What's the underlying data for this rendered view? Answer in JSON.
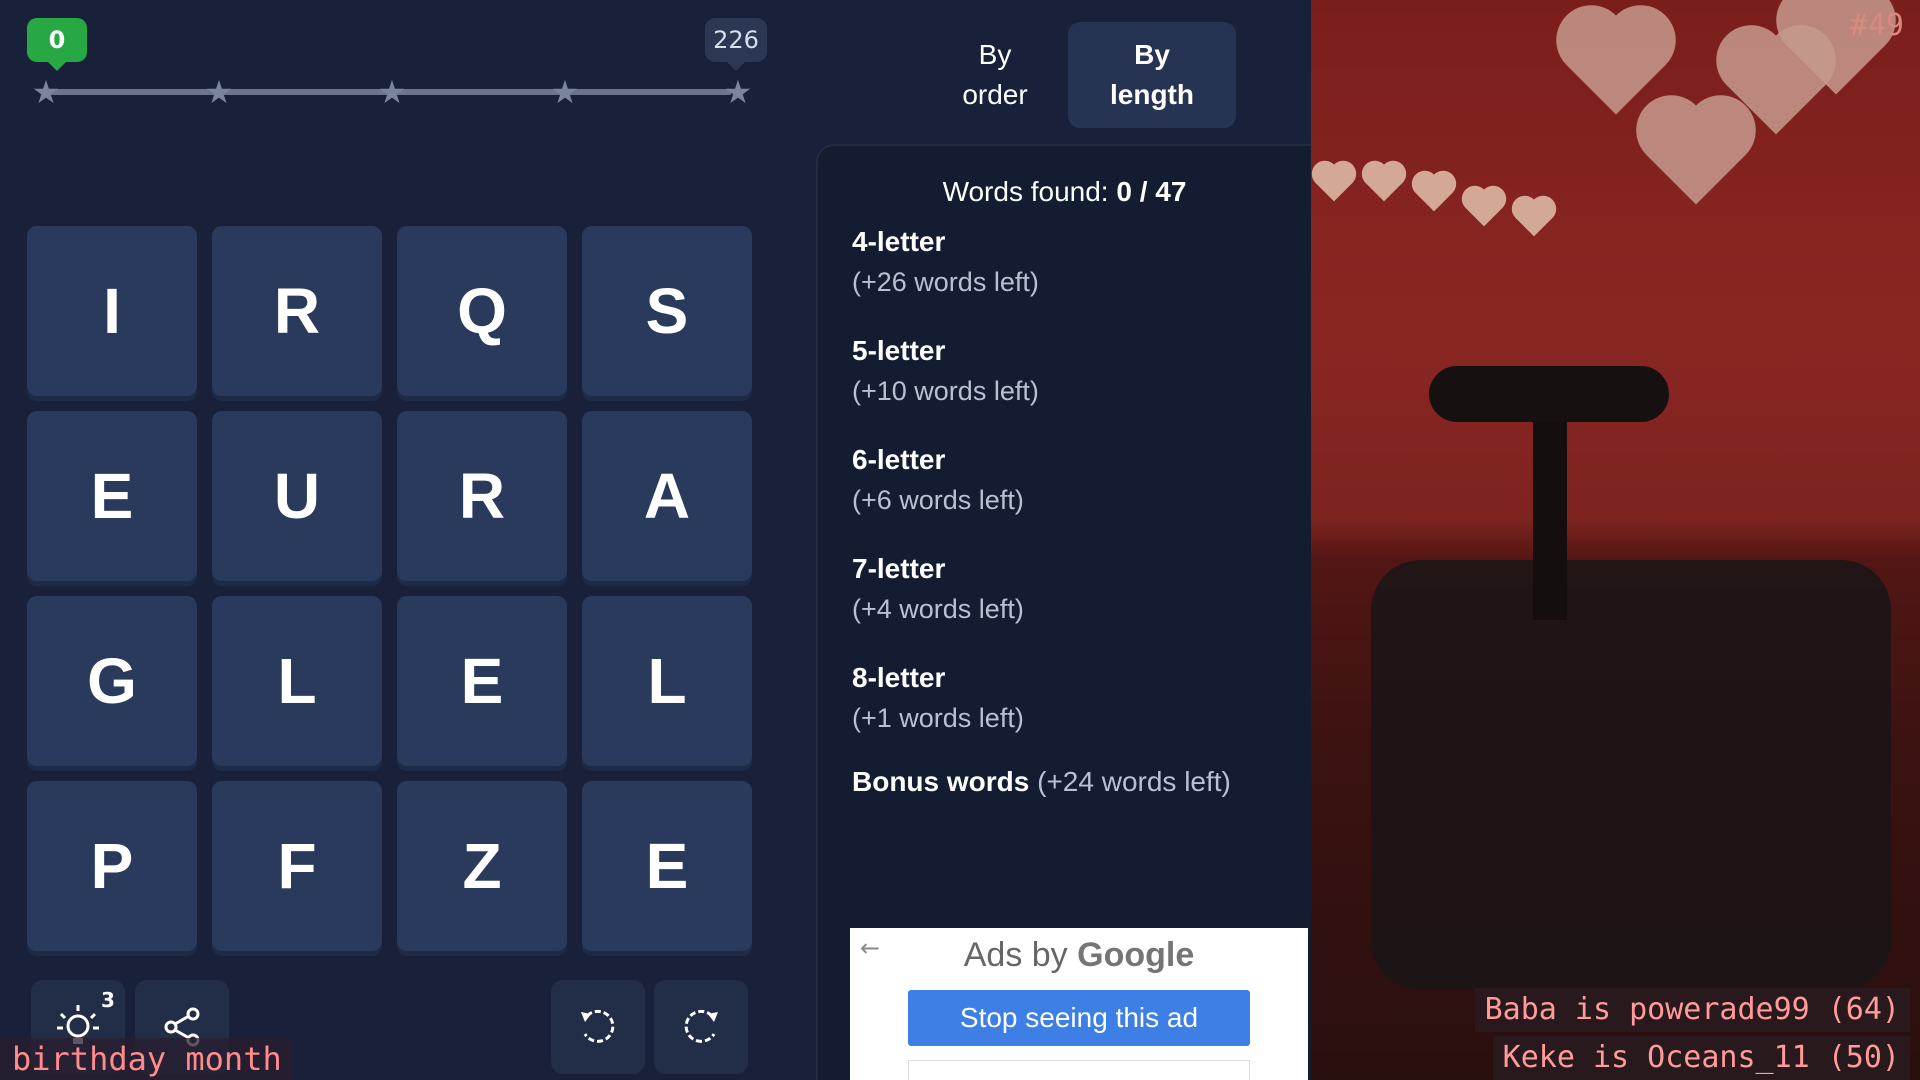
{
  "progress": {
    "current_score": "0",
    "max_score": "226",
    "stars": 5
  },
  "sort": {
    "by_order_label": "By\norder",
    "by_length_label": "By\nlength",
    "active": "by_length"
  },
  "grid": {
    "letters": [
      [
        "I",
        "R",
        "Q",
        "S"
      ],
      [
        "E",
        "U",
        "R",
        "A"
      ],
      [
        "G",
        "L",
        "E",
        "L"
      ],
      [
        "P",
        "F",
        "Z",
        "E"
      ]
    ]
  },
  "words": {
    "found_label": "Words found:",
    "found_value": "0 / 47",
    "groups": [
      {
        "title": "4-letter",
        "left": "(+26 words left)"
      },
      {
        "title": "5-letter",
        "left": "(+10 words left)"
      },
      {
        "title": "6-letter",
        "left": "(+6 words left)"
      },
      {
        "title": "7-letter",
        "left": "(+4 words left)"
      },
      {
        "title": "8-letter",
        "left": "(+1 words left)"
      }
    ],
    "bonus_title": "Bonus words",
    "bonus_left": "(+24 words left)"
  },
  "controls": {
    "hint_count": "3",
    "hint_icon": "lightbulb-icon",
    "share_icon": "share-icon",
    "rotate_left_icon": "rotate-left-icon",
    "rotate_right_icon": "rotate-right-icon"
  },
  "ad": {
    "label_prefix": "Ads by",
    "label_brand": "Google",
    "stop_label": "Stop seeing this ad"
  },
  "overlay": {
    "birthday_text": "birthday month",
    "episode": "#49",
    "chat": [
      "Baba is powerade99 (64)",
      "Keke is Oceans_11 (50)"
    ]
  },
  "colors": {
    "background": "#19213a",
    "tile": "#2a3a5c",
    "score_badge": "#27a844",
    "ad_button": "#3e7fe6",
    "overlay_text": "#ff8b8b"
  }
}
